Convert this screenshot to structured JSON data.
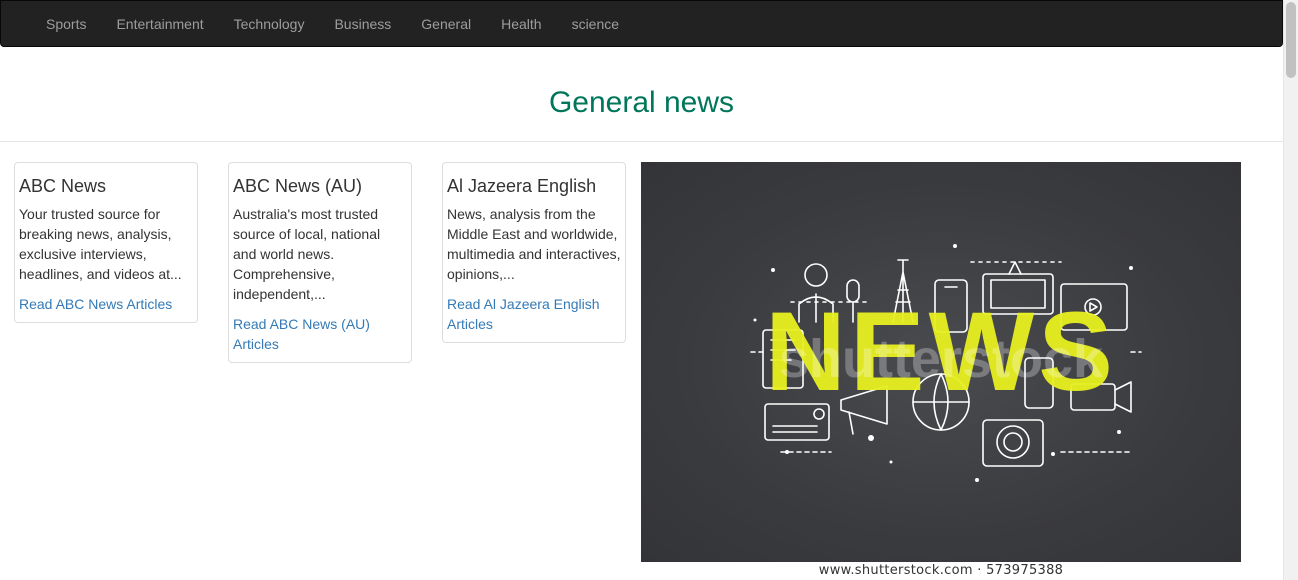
{
  "nav": {
    "items": [
      {
        "label": "Sports"
      },
      {
        "label": "Entertainment"
      },
      {
        "label": "Technology"
      },
      {
        "label": "Business"
      },
      {
        "label": "General"
      },
      {
        "label": "Health"
      },
      {
        "label": "science"
      }
    ]
  },
  "page": {
    "title": "General news"
  },
  "sources": [
    {
      "name": "ABC News",
      "description": "Your trusted source for breaking news, analysis, exclusive interviews, headlines, and videos at...",
      "link": "Read ABC News Articles"
    },
    {
      "name": "ABC News (AU)",
      "description": "Australia's most trusted source of local, national and world news. Comprehensive, independent,...",
      "link": "Read ABC News (AU) Articles"
    },
    {
      "name": "Al Jazeera English",
      "description": "News, analysis from the Middle East and worldwide, multimedia and interactives, opinions,...",
      "link": "Read Al Jazeera English Articles"
    }
  ],
  "image": {
    "headline_text": "NEWS",
    "watermark": "shutterstock",
    "caption": "www.shutterstock.com · 573975388",
    "colors": {
      "background": "#3d3e42",
      "headline": "#e8f020",
      "lines": "#ffffff"
    }
  },
  "colors": {
    "navbar_bg": "#222222",
    "nav_text": "#9d9d9d",
    "title": "#00765a",
    "link": "#337ab7"
  }
}
